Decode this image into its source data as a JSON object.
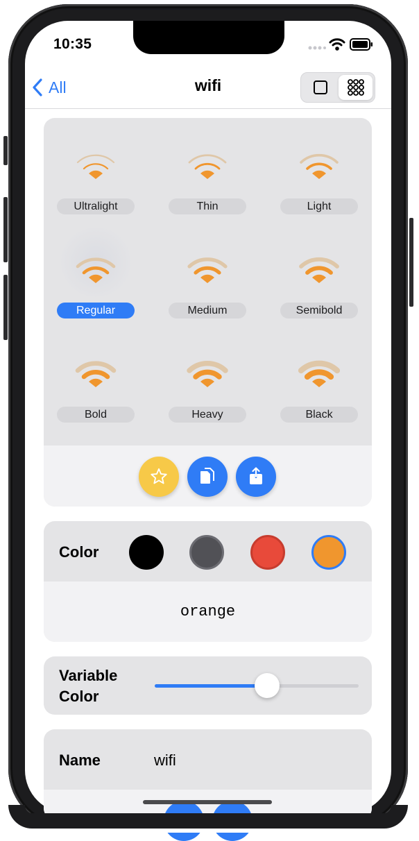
{
  "status_bar": {
    "time": "10:35"
  },
  "nav": {
    "back_label": "All",
    "title": "wifi"
  },
  "symbol": {
    "weights": [
      {
        "label": "Ultralight",
        "selected": false
      },
      {
        "label": "Thin",
        "selected": false
      },
      {
        "label": "Light",
        "selected": false
      },
      {
        "label": "Regular",
        "selected": true
      },
      {
        "label": "Medium",
        "selected": false
      },
      {
        "label": "Semibold",
        "selected": false
      },
      {
        "label": "Bold",
        "selected": false
      },
      {
        "label": "Heavy",
        "selected": false
      },
      {
        "label": "Black",
        "selected": false
      }
    ],
    "primary_color": "#f0962e",
    "secondary_color": "#dfc7a8"
  },
  "actions": [
    {
      "icon": "star-icon",
      "color": "#f7c948"
    },
    {
      "icon": "copy-icon",
      "color": "#2f7cf6"
    },
    {
      "icon": "share-icon",
      "color": "#2f7cf6"
    }
  ],
  "color": {
    "heading": "Color",
    "swatches": [
      {
        "value": "#000000",
        "selected": false
      },
      {
        "value": "#515156",
        "selected": false
      },
      {
        "value": "#e84a3a",
        "selected": false
      },
      {
        "value": "#f0962e",
        "selected": true
      }
    ],
    "selected_name": "orange"
  },
  "variable_color": {
    "heading_line1": "Variable",
    "heading_line2": "Color",
    "value": 0.55
  },
  "name": {
    "heading": "Name",
    "value": "wifi"
  },
  "accent_color": "#2f7cf6"
}
